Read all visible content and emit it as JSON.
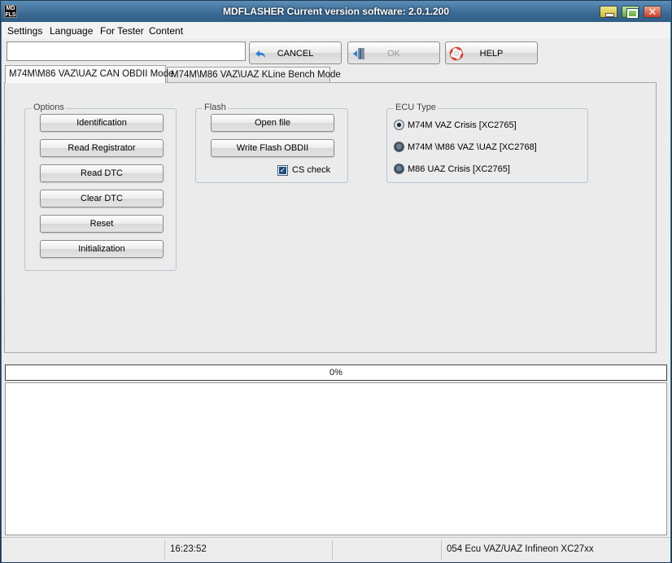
{
  "window": {
    "app_icon_text": "MD FLS",
    "title": "MDFLASHER  Current version software: 2.0.1.200"
  },
  "menu": [
    "Settings",
    "Language",
    "For Tester",
    "Content"
  ],
  "toolbar": {
    "input_value": "",
    "cancel_label": "CANCEL",
    "ok_label": "OK",
    "help_label": "HELP"
  },
  "tabs": [
    {
      "label": "M74M\\M86  VAZ\\UAZ CAN OBDII Mode",
      "active": true
    },
    {
      "label": "M74M\\M86  VAZ\\UAZ KLine Bench Mode",
      "active": false
    }
  ],
  "options": {
    "title": "Options",
    "buttons": [
      "Identification",
      "Read Registrator",
      "Read DTC",
      "Clear DTC",
      "Reset",
      "Initialization"
    ]
  },
  "flash": {
    "title": "Flash",
    "open_file_label": "Open file",
    "write_label": "Write Flash OBDII",
    "cs_check_label": "CS check",
    "cs_check_checked": true
  },
  "ecu": {
    "title": "ECU Type",
    "options": [
      {
        "label": "M74M VAZ Crisis [XC2765]",
        "checked": true
      },
      {
        "label": "M74M \\M86 VAZ \\UAZ [XC2768]",
        "checked": false
      },
      {
        "label": "M86 UAZ Crisis [XC2765]",
        "checked": false
      }
    ]
  },
  "progress": {
    "value": 0,
    "text": "0%"
  },
  "status": {
    "time": "16:23:52",
    "ecu_info": "054 Ecu VAZ/UAZ Infineon XC27xx"
  },
  "colors": {
    "title_bar": "#3a6b94",
    "progress_fill": "#3c7fc1"
  }
}
